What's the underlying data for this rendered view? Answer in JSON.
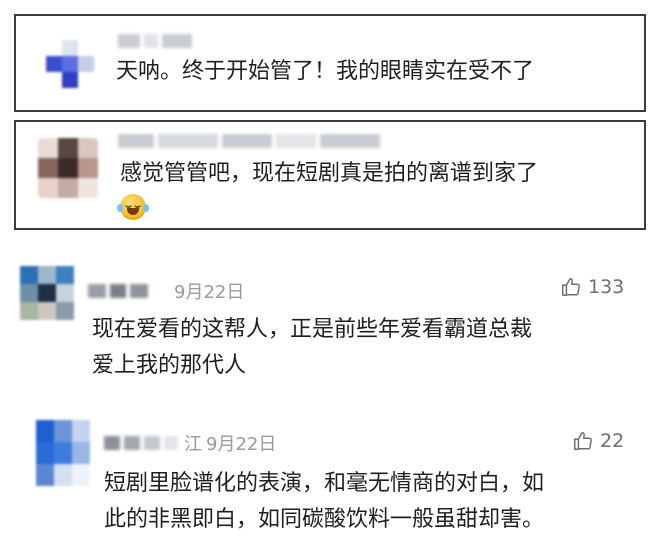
{
  "comments": [
    {
      "text_lines": [
        "天呐。终于开始管了！我的眼睛实在受不了"
      ],
      "avatar_colors": [
        "#ffffff",
        "#d8dce8",
        "#ffffff",
        "#3a4fd0",
        "#5b6fe0",
        "#c8cde8",
        "#ffffff",
        "#2d3fc4",
        "#ffffff"
      ]
    },
    {
      "text_lines": [
        "感觉管管吧，现在短剧真是拍的离谱到家了"
      ],
      "emoji": "laughing-tears-emoji",
      "avatar_colors": [
        "#e9dcd6",
        "#5a4744",
        "#d9c7c0",
        "#8a6660",
        "#3b2c2a",
        "#b99690",
        "#e4d3cc",
        "#c7aaa2",
        "#f0e4df"
      ]
    },
    {
      "date": "9月22日",
      "likes": "133",
      "text_lines": [
        "现在爱看的这帮人，正是前些年爱看霸道总裁",
        "爱上我的那代人"
      ],
      "avatar_colors": [
        "#2d6fb3",
        "#9fb7cc",
        "#3f7fbf",
        "#6f8fa8",
        "#1c2f44",
        "#c9d3dc",
        "#a8b5a0",
        "#d0c6c0",
        "#8a9aa8"
      ]
    },
    {
      "location": "江",
      "date": "9月22日",
      "likes": "22",
      "text_lines": [
        "短剧里脸谱化的表演，和毫无情商的对白，如",
        "此的非黑即白，如同碳酸饮料一般虽甜却害。"
      ],
      "avatar_colors": [
        "#1f5fd0",
        "#6d93d8",
        "#c3d2ee",
        "#2a6ad6",
        "#3d7be0",
        "#9ab6e6",
        "#5a86d4",
        "#d4e0f2",
        "#eef3fb"
      ]
    }
  ],
  "icons": {
    "like": "thumbs-up-icon"
  }
}
